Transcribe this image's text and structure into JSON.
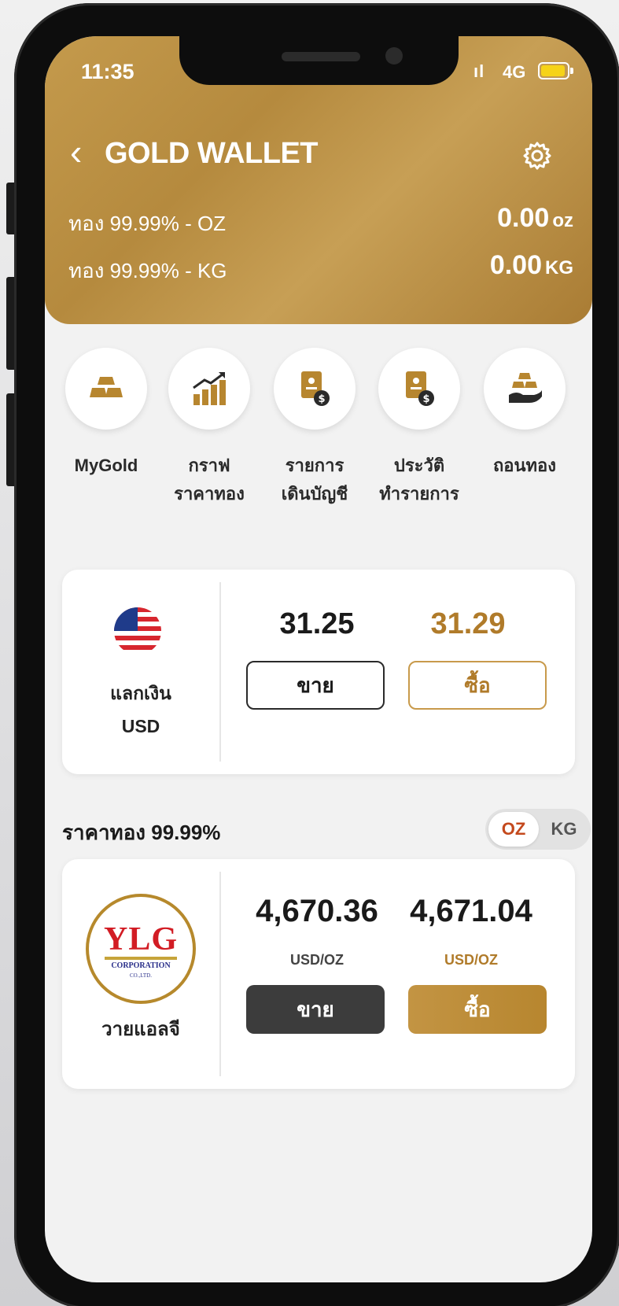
{
  "status_bar": {
    "time": "11:35",
    "network": "4G"
  },
  "header": {
    "title": "GOLD WALLET",
    "holdings": [
      {
        "label": "ทอง 99.99% - OZ",
        "value": "0.00",
        "unit": "oz"
      },
      {
        "label": "ทอง 99.99% - KG",
        "value": "0.00",
        "unit": "KG"
      }
    ]
  },
  "menu": [
    {
      "label_line1": "MyGold",
      "label_line2": ""
    },
    {
      "label_line1": "กราฟ",
      "label_line2": "ราคาทอง"
    },
    {
      "label_line1": "รายการ",
      "label_line2": "เดินบัญชี"
    },
    {
      "label_line1": "ประวัติ",
      "label_line2": "ทำรายการ"
    },
    {
      "label_line1": "ถอนทอง",
      "label_line2": ""
    }
  ],
  "fx": {
    "label_line1": "แลกเงิน",
    "label_line2": "USD",
    "sell_price": "31.25",
    "buy_price": "31.29",
    "sell_label": "ขาย",
    "buy_label": "ซื้อ"
  },
  "gold": {
    "section_title": "ราคาทอง 99.99%",
    "toggle": {
      "oz": "OZ",
      "kg": "KG",
      "selected": "OZ"
    },
    "shop_name": "วายแอลจี",
    "logo": {
      "text": "YLG",
      "sub1": "CORPORATION",
      "sub2": "CO.,LTD."
    },
    "sell_price": "4,670.36",
    "buy_price": "4,671.04",
    "sell_unit": "USD/OZ",
    "buy_unit": "USD/OZ",
    "sell_label": "ขาย",
    "buy_label": "ซื้อ"
  },
  "colors": {
    "brand_gold": "#b58a3e",
    "accent_buy": "#b07b2a",
    "sell_dark": "#3c3c3c"
  }
}
